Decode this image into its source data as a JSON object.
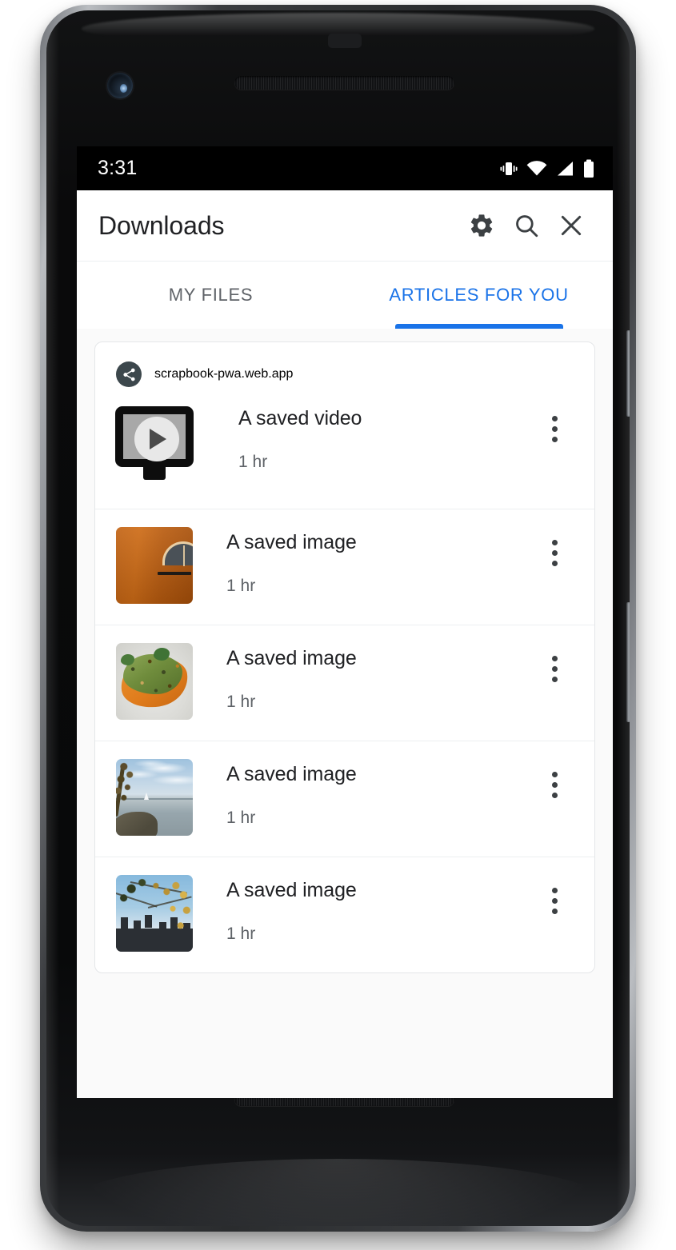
{
  "device": {
    "hardware": {
      "front_camera": "front-camera",
      "earpiece": "earpiece-speaker",
      "bottom_speaker": "bottom-speaker",
      "power_button": "power-button",
      "volume_button": "volume-button"
    }
  },
  "status_bar": {
    "time": "3:31",
    "icons": [
      "vibrate-icon",
      "wifi-icon",
      "cellular-signal-icon",
      "battery-icon"
    ]
  },
  "toolbar": {
    "title": "Downloads",
    "actions": [
      {
        "name": "settings-button",
        "icon": "gear-icon"
      },
      {
        "name": "search-button",
        "icon": "search-icon"
      },
      {
        "name": "close-button",
        "icon": "close-icon"
      }
    ]
  },
  "tabs": {
    "items": [
      {
        "label": "MY FILES",
        "active": false
      },
      {
        "label": "ARTICLES FOR YOU",
        "active": true
      }
    ],
    "active_color": "#1a73e8",
    "inactive_color": "#5f6368"
  },
  "card": {
    "source_domain": "scrapbook-pwa.web.app",
    "source_badge_icon": "share-icon",
    "source_badge_color": "#3c474c",
    "rows": [
      {
        "title": "A saved video",
        "subtitle": "1 hr",
        "thumb_type": "video-player-icon",
        "menu_icon": "overflow-menu-icon"
      },
      {
        "title": "A saved image",
        "subtitle": "1 hr",
        "thumb_type": "orange-wall-photo",
        "menu_icon": "overflow-menu-icon"
      },
      {
        "title": "A saved image",
        "subtitle": "1 hr",
        "thumb_type": "avocado-toast-photo",
        "menu_icon": "overflow-menu-icon"
      },
      {
        "title": "A saved image",
        "subtitle": "1 hr",
        "thumb_type": "lake-shore-photo",
        "menu_icon": "overflow-menu-icon"
      },
      {
        "title": "A saved image",
        "subtitle": "1 hr",
        "thumb_type": "city-skyline-photo",
        "menu_icon": "overflow-menu-icon"
      }
    ]
  },
  "colors": {
    "accent": "#1a73e8",
    "text_primary": "#202124",
    "text_secondary": "#5f6368",
    "surface": "#ffffff",
    "background": "#fafafa",
    "status_bar": "#000000"
  }
}
